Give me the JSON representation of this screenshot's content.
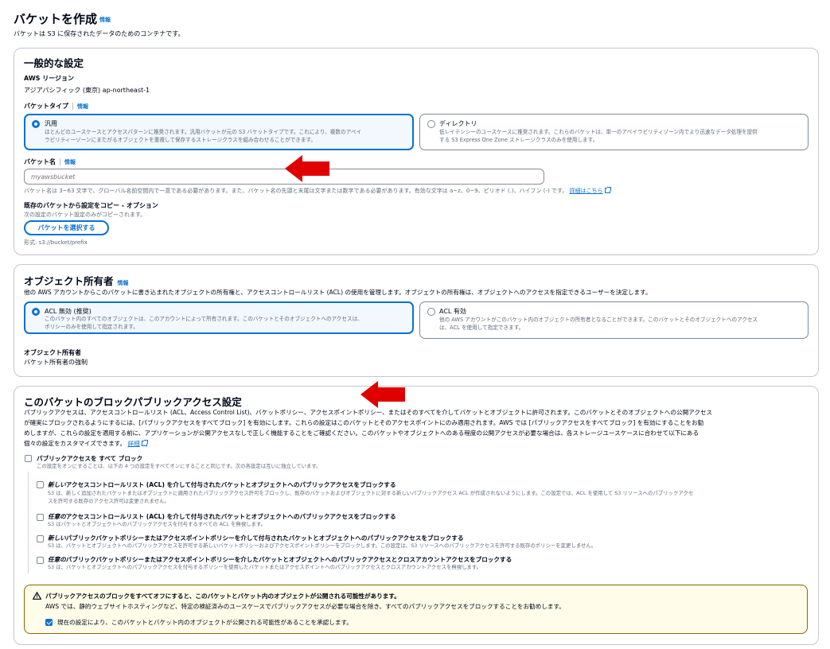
{
  "page": {
    "title": "バケットを作成",
    "info": "情報",
    "subtitle": "バケットは S3 に保存されたデータのためのコンテナです。"
  },
  "general": {
    "heading": "一般的な設定",
    "region_label": "AWS リージョン",
    "region_value": "アジアパシフィック (東京) ap-northeast-1",
    "bucket_type_label": "バケットタイプ",
    "info": "情報",
    "types": [
      {
        "title": "汎用",
        "desc1": "ほとんどのユースケースとアクセスパターンに推奨されます。汎用バケットが元の S3 バケットタイプです。これにより、複数のアベイ",
        "desc2": "ラビリティーゾーンにまたがるオブジェクトを重複して保存するストレージクラスを組み合わせることができます。"
      },
      {
        "title": "ディレクトリ",
        "desc1": "低レイテンシーのユースケースに推奨されます。これらのバケットは、単一のアベイラビリティゾーン内でより迅速なデータ処理を提供",
        "desc2": "する S3 Express One Zone ストレージクラスのみを使用します。"
      }
    ],
    "bucket_name_label": "バケット名",
    "bucket_name_placeholder": "myawsbucket",
    "bucket_name_hint": "バケット名は 3~63 文字で、グローバル名前空間内で一意である必要があります。また、バケット名の先頭と末尾は文字または数字である必要があります。有効な文字は a~z、0~9、ピリオド (.)、ハイフン (-) です。",
    "bucket_name_link": "詳細はこちら",
    "copy_label": "既存のバケットから設定をコピー - オプション",
    "copy_hint": "次の設定のバケット設定のみがコピーされます。",
    "choose_button": "バケットを選択する",
    "format_hint": "形式: s3://bucket/prefix"
  },
  "ownership": {
    "heading": "オブジェクト所有者",
    "info": "情報",
    "desc": "他の AWS アカウントからこのバケットに書き込まれたオブジェクトの所有権と、アクセスコントロールリスト (ACL) の使用を管理します。オブジェクトの所有権は、オブジェクトへのアクセスを指定できるユーザーを決定します。",
    "options": [
      {
        "title": "ACL 無効 (推奨)",
        "desc1": "このバケット内のすべてのオブジェクトは、このアカウントによって所有されます。このバケットとそのオブジェクトへのアクセスは、",
        "desc2": "ポリシーのみを使用して指定されます。"
      },
      {
        "title": "ACL 有効",
        "desc1": "他の AWS アカウントがこのバケット内のオブジェクトの所有者となることができます。このバケットとそのオブジェクトへのアクセス",
        "desc2": "は、ACL を使用して指定できます。"
      }
    ],
    "owner_label": "オブジェクト所有者",
    "owner_value": "バケット所有者の強制"
  },
  "block": {
    "heading": "このバケットのブロックパブリックアクセス設定",
    "desc1": "パブリックアクセスは、アクセスコントロールリスト (ACL、Access Control List)、バケットポリシー、アクセスポイントポリシー、またはそのすべてを介してバケットとオブジェクトに許可されます。このバケットとそのオブジェクトへの公開アクセス",
    "desc2": "が確実にブロックされるようにするには、[パブリックアクセスをすべてブロック] を有効にします。これらの設定はこのバケットとそのアクセスポイントにのみ適用されます。AWS では [パブリックアクセスをすべてブロック] を有効にすることをお勧",
    "desc3": "めしますが、これらの設定を適用する前に、アプリケーションが公開アクセスなしで正しく機能することをご確認ください。このバケットやオブジェクトへのある程度の公開アクセスが必要な場合は、各ストレージユースケースに合わせて以下にある",
    "desc4": "個々の設定をカスタマイズできます。",
    "link": "詳細",
    "all_title": "パブリックアクセスを すべて ブロック",
    "all_desc": "この設定をオンにすることは、以下の 4 つの設定をすべてオンにすることと同じです。次の各設定は互いに独立しています。",
    "opts": [
      {
        "em": "新しい",
        "title": "アクセスコントロールリスト (ACL) を介して付与されたバケットとオブジェクトへのパブリックアクセスをブロックする",
        "desc1": "S3 は、新しく追加されたバケットまたはオブジェクトに適用されたパブリックアクセス許可をブロックし、既存のバケットおよびオブジェクトに対する新しいパブリックアクセス ACL が作成されないようにします。この設定では、ACL を使用して S3 リソースへのパブリックアクセ",
        "desc2": "スを許可する既存のアクセス許可は変更されません。"
      },
      {
        "em": "任意の",
        "title": "アクセスコントロールリスト (ACL) を介して付与されたバケットとオブジェクトへのパブリックアクセスをブロックする",
        "desc1": "S3 はバケットとオブジェクトへのパブリックアクセスを付与するすべての ACL を無視します。",
        "desc2": ""
      },
      {
        "em": "新しい",
        "title": "パブリックバケットポリシーまたはアクセスポイントポリシーを介して付与されたバケットとオブジェクトへのパブリックアクセスをブロックする",
        "desc1": "S3 は、バケットとオブジェクトへのパブリックアクセスを許可する新しいバケットポリシーおよびアクセスポイントポリシーをブロックします。この設定は、S3 リソースへのパブリックアクセスを許可する既存のポリシーを変更しません。",
        "desc2": ""
      },
      {
        "em": "任意の",
        "title": "パブリックバケットポリシーまたはアクセスポイントポリシーを介したバケットとオブジェクトへのパブリックアクセスとクロスアカウントアクセスをブロックする",
        "desc1": "S3 は、バケットとオブジェクトへのパブリックアクセスを付与するポリシーを使用したバケットまたはアクセスポイントへのパブリックアクセスとクロスアカウントアクセスを無視します。",
        "desc2": ""
      }
    ],
    "warn_title": "パブリックアクセスのブロックをすべてオフにすると、このバケットとバケット内のオブジェクトが公開される可能性があります。",
    "warn_desc": "AWS では、静的ウェブサイトホスティングなど、特定の検証済みのユースケースでパブリックアクセスが必要な場合を除き、すべてのパブリックアクセスをブロックすることをお勧めします。",
    "ack_label": "現在の設定により、このバケットとバケット内のオブジェクトが公開される可能性があることを承認します。"
  },
  "colors": {
    "accent": "#0972d3",
    "annotation_arrow": "#e00000",
    "warning_bg": "#fffce9",
    "warning_border": "#8d6605"
  }
}
